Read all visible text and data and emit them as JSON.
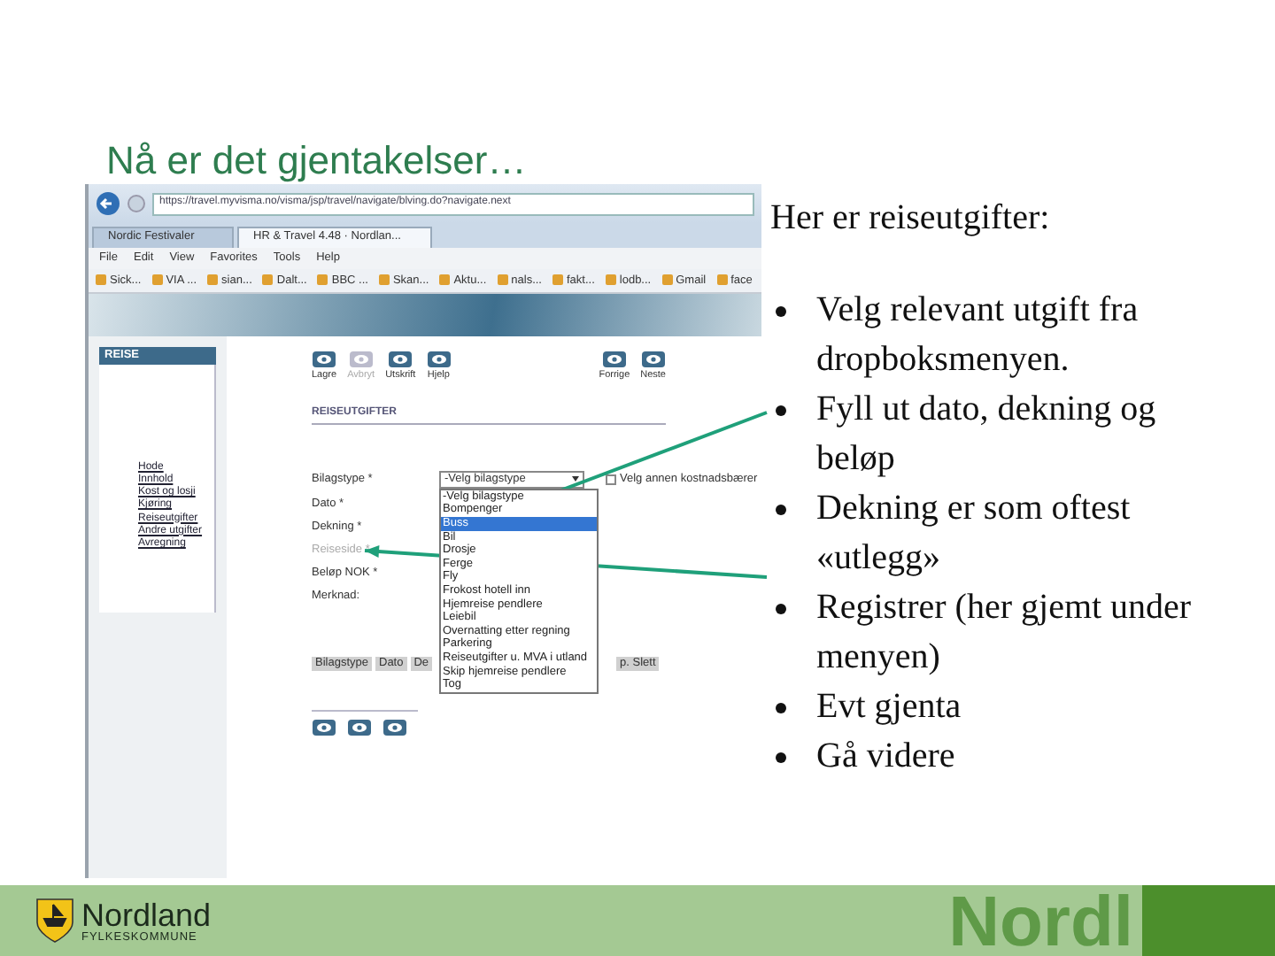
{
  "slide_title": "Nå er det gjentakelser…",
  "screenshot": {
    "address_bar": "https://travel.myvisma.no/visma/jsp/travel/navigate/blving.do?navigate.next",
    "browser_tabs": [
      {
        "label": "Nordic Festivaler",
        "selected": false
      },
      {
        "label": "HR & Travel 4.48 · Nordlan...",
        "selected": true
      }
    ],
    "menu": [
      "File",
      "Edit",
      "View",
      "Favorites",
      "Tools",
      "Help"
    ],
    "favorites": [
      "Sick...",
      "VIA ...",
      "sian...",
      "Dalt...",
      "BBC ...",
      "Skan...",
      "Aktu...",
      "nals...",
      "fakt...",
      "lodb...",
      "Gmail",
      "face"
    ],
    "side_panel": {
      "title": "REISE",
      "links": [
        "Hode",
        "Innhold",
        "Kost og losji",
        "Kjøring",
        "Reiseutgifter",
        "Andre utgifter",
        "Avregning"
      ]
    },
    "toolbar_left": [
      {
        "label": "Lagre",
        "disabled": false
      },
      {
        "label": "Avbryt",
        "disabled": true
      },
      {
        "label": "Utskrift",
        "disabled": false
      },
      {
        "label": "Hjelp",
        "disabled": false
      }
    ],
    "toolbar_right": [
      {
        "label": "Forrige",
        "disabled": false
      },
      {
        "label": "Neste",
        "disabled": false
      }
    ],
    "section_title": "REISEUTGIFTER",
    "form_fields": [
      {
        "label": "Bilagstype *",
        "disabled": false
      },
      {
        "label": "Dato *",
        "disabled": false
      },
      {
        "label": "Dekning *",
        "disabled": false
      },
      {
        "label": "Reiseside *",
        "disabled": true
      },
      {
        "label": "Beløp NOK *",
        "disabled": false
      },
      {
        "label": "Merknad:",
        "disabled": false
      }
    ],
    "select": {
      "value": "-Velg bilagstype"
    },
    "checkbox": {
      "label": "Velg annen kostnadsbærer",
      "checked": false
    },
    "dropdown_options": [
      {
        "label": "-Velg bilagstype",
        "selected": false
      },
      {
        "label": "Bompenger",
        "selected": false
      },
      {
        "label": "Buss",
        "selected": true
      },
      {
        "label": "Bil",
        "selected": false
      },
      {
        "label": "Drosje",
        "selected": false
      },
      {
        "label": "Ferge",
        "selected": false
      },
      {
        "label": "Fly",
        "selected": false
      },
      {
        "label": "Frokost hotell inn",
        "selected": false
      },
      {
        "label": "Hjemreise pendlere",
        "selected": false
      },
      {
        "label": "Leiebil",
        "selected": false
      },
      {
        "label": "Overnatting etter regning",
        "selected": false
      },
      {
        "label": "Parkering",
        "selected": false
      },
      {
        "label": "Reiseutgifter u. MVA i utland",
        "selected": false
      },
      {
        "label": "Skip hjemreise pendlere",
        "selected": false
      },
      {
        "label": "Tog",
        "selected": false
      }
    ],
    "table_header": [
      "Bilagstype",
      "Dato",
      "De"
    ],
    "table_header_tail": "p. Slett"
  },
  "intro": "Her er reiseutgifter:",
  "bullets": [
    "Velg relevant utgift fra dropboksmenyen.",
    "Fyll ut dato, dekning og beløp",
    "Dekning er som oftest «utlegg»",
    "Registrer (her gjemt under menyen)",
    "Evt gjenta",
    "Gå videre"
  ],
  "footer": {
    "logo_name": "Nordland",
    "logo_sub": "FYLKESKOMMUNE",
    "decor_text": "Nordl"
  }
}
